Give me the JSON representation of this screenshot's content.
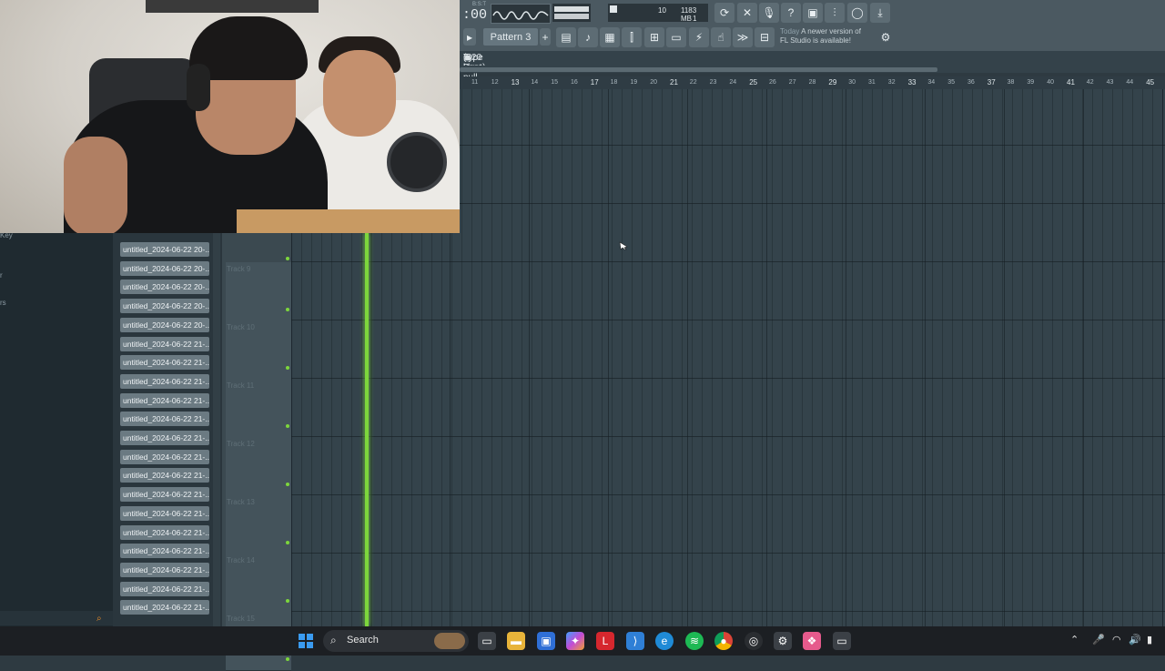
{
  "toolbar": {
    "time_small": "B:S:T",
    "time": ":00",
    "cpu_value": "10",
    "memory": "1183 MB",
    "polyphony": "1",
    "pattern_label": "Pattern 3",
    "news_today": "Today",
    "news_text_1": "A newer version of",
    "news_text_2": "FL Studio is available!"
  },
  "playlist": {
    "title": "Type Beat pull up _ 2023 _",
    "bitrate": "(320  kbps)",
    "ruler": [
      {
        "label": "11",
        "major": false
      },
      {
        "label": "12",
        "major": false
      },
      {
        "label": "13",
        "major": true
      },
      {
        "label": "14",
        "major": false
      },
      {
        "label": "15",
        "major": false
      },
      {
        "label": "16",
        "major": false
      },
      {
        "label": "17",
        "major": true
      },
      {
        "label": "18",
        "major": false
      },
      {
        "label": "19",
        "major": false
      },
      {
        "label": "20",
        "major": false
      },
      {
        "label": "21",
        "major": true
      },
      {
        "label": "22",
        "major": false
      },
      {
        "label": "23",
        "major": false
      },
      {
        "label": "24",
        "major": false
      },
      {
        "label": "25",
        "major": true
      },
      {
        "label": "26",
        "major": false
      },
      {
        "label": "27",
        "major": false
      },
      {
        "label": "28",
        "major": false
      },
      {
        "label": "29",
        "major": true
      },
      {
        "label": "30",
        "major": false
      },
      {
        "label": "31",
        "major": false
      },
      {
        "label": "32",
        "major": false
      },
      {
        "label": "33",
        "major": true
      },
      {
        "label": "34",
        "major": false
      },
      {
        "label": "35",
        "major": false
      },
      {
        "label": "36",
        "major": false
      },
      {
        "label": "37",
        "major": true
      },
      {
        "label": "38",
        "major": false
      },
      {
        "label": "39",
        "major": false
      },
      {
        "label": "40",
        "major": false
      },
      {
        "label": "41",
        "major": true
      },
      {
        "label": "42",
        "major": false
      },
      {
        "label": "43",
        "major": false
      },
      {
        "label": "44",
        "major": false
      },
      {
        "label": "45",
        "major": true
      }
    ],
    "tracks": [
      "Track 9",
      "Track 10",
      "Track 11",
      "Track 12",
      "Track 13",
      "Track 14",
      "Track 15"
    ]
  },
  "browser": {
    "labels": [
      "Key",
      "r",
      "rs"
    ],
    "clips": [
      "untitled_2024-06-22 20-...",
      "untitled_2024-06-22 20-...",
      "untitled_2024-06-22 20-...",
      "untitled_2024-06-22 20-...",
      "untitled_2024-06-22 20-...",
      "untitled_2024-06-22 21-...",
      "untitled_2024-06-22 21-...",
      "untitled_2024-06-22 21-...",
      "untitled_2024-06-22 21-...",
      "untitled_2024-06-22 21-...",
      "untitled_2024-06-22 21-...",
      "untitled_2024-06-22 21-...",
      "untitled_2024-06-22 21-...",
      "untitled_2024-06-22 21-...",
      "untitled_2024-06-22 21-...",
      "untitled_2024-06-22 21-...",
      "untitled_2024-06-22 21-...",
      "untitled_2024-06-22 21-...",
      "untitled_2024-06-22 21-...",
      "untitled_2024-06-22 21-..."
    ]
  },
  "taskbar": {
    "search_label": "Search",
    "icons": [
      "windows-start-icon",
      "file-explorer-icon",
      "folder-icon",
      "store-icon",
      "copilot-icon",
      "l-app-icon",
      "vscode-icon",
      "edge-icon",
      "spotify-icon",
      "chrome-icon",
      "obs-icon",
      "settings-icon",
      "fl-studio-icon",
      "window-icon"
    ]
  },
  "colors": {
    "playhead": "#7dd63c",
    "accent": "#e88c2a",
    "grid": "#34434b"
  }
}
